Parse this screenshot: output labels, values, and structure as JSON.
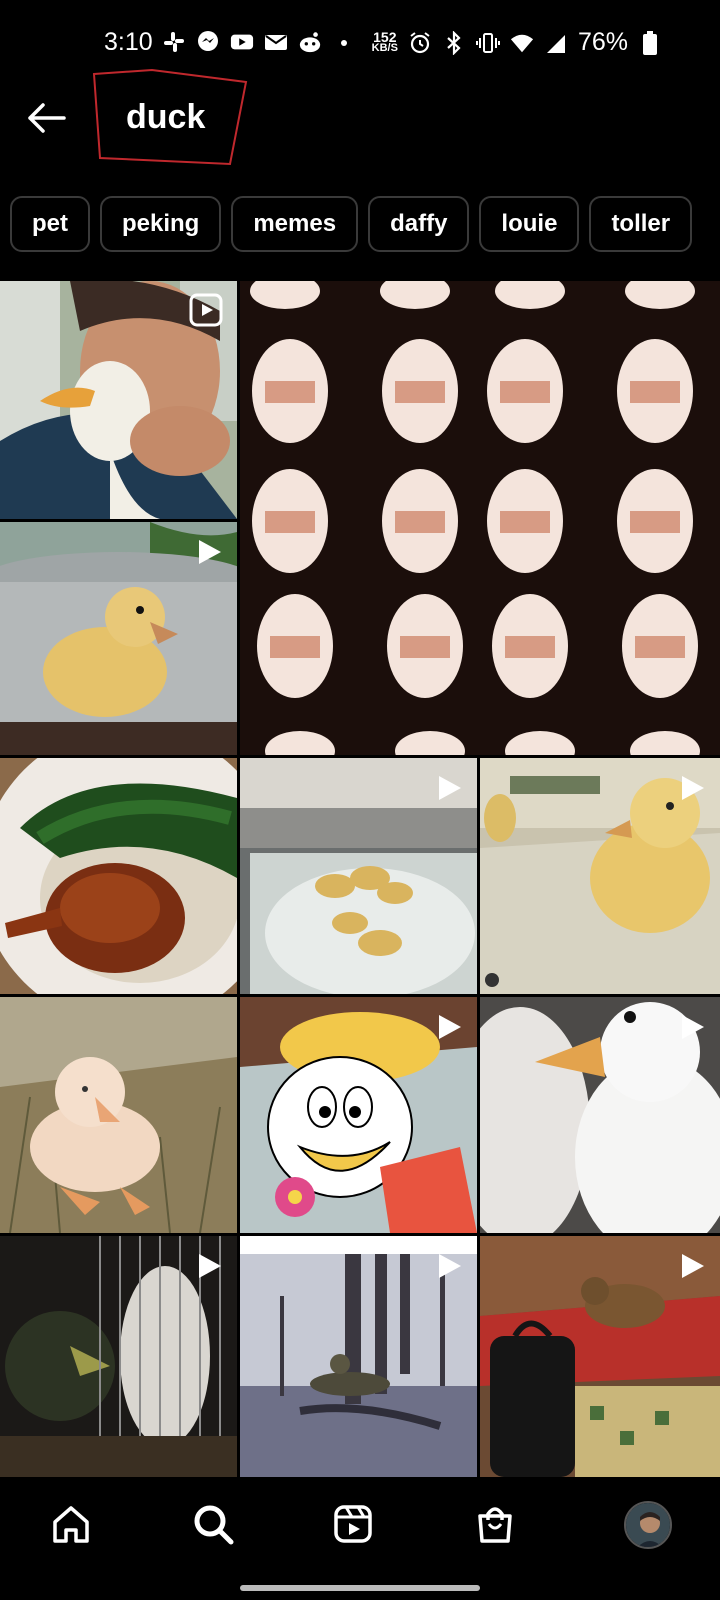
{
  "status_bar": {
    "time": "3:10",
    "speed_value": "152",
    "speed_unit": "KB/S",
    "battery": "76%"
  },
  "search": {
    "query": "duck"
  },
  "chips": [
    "pet",
    "peking",
    "memes",
    "daffy",
    "louie",
    "toller"
  ],
  "colors": {
    "background": "#000000",
    "chip_border": "#3a3a3a",
    "annotation": "#c0282d"
  },
  "tiles": [
    {
      "name": "man-holding-white-duck",
      "type": "reel"
    },
    {
      "name": "large-pattern-video",
      "type": "video"
    },
    {
      "name": "duckling-on-metal-bowl",
      "type": "video"
    },
    {
      "name": "roast-duck-meal",
      "type": "image"
    },
    {
      "name": "ducklings-in-bathtub",
      "type": "video"
    },
    {
      "name": "duckling-in-water",
      "type": "video"
    },
    {
      "name": "fluffy-duckling-in-grass",
      "type": "image"
    },
    {
      "name": "cartoon-duck-character",
      "type": "video"
    },
    {
      "name": "white-duck-closeup",
      "type": "video"
    },
    {
      "name": "ducks-behind-fence",
      "type": "video"
    },
    {
      "name": "hunter-in-swamp",
      "type": "video"
    },
    {
      "name": "duck-on-bag",
      "type": "video"
    }
  ],
  "nav": [
    "home-icon",
    "search-icon",
    "reels-icon",
    "shop-icon",
    "profile-avatar"
  ]
}
